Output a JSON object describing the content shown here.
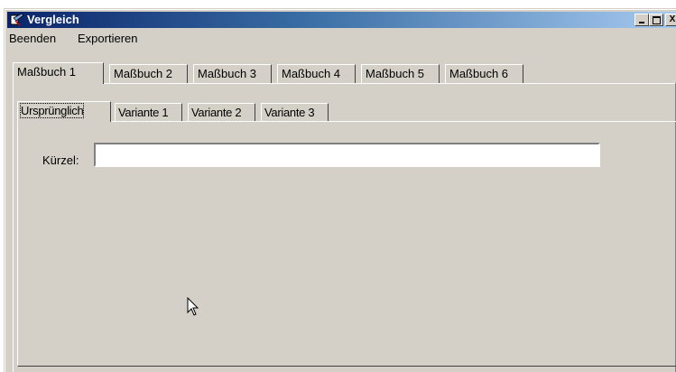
{
  "window": {
    "title": "Vergleich",
    "title_icon": "app-icon"
  },
  "title_buttons": {
    "minimize": "_",
    "maximize": "□",
    "close": "X"
  },
  "menu": [
    {
      "label": "Beenden"
    },
    {
      "label": "Exportieren"
    }
  ],
  "tabs_primary": [
    {
      "label": "Maßbuch 1",
      "active": true
    },
    {
      "label": "Maßbuch 2"
    },
    {
      "label": "Maßbuch 3"
    },
    {
      "label": "Maßbuch 4"
    },
    {
      "label": "Maßbuch 5"
    },
    {
      "label": "Maßbuch 6"
    }
  ],
  "tabs_secondary": [
    {
      "label": "Ursprünglich",
      "active": true
    },
    {
      "label": "Variante 1"
    },
    {
      "label": "Variante 2"
    },
    {
      "label": "Variante 3"
    }
  ],
  "form": {
    "kuerzel_label": "Kürzel:",
    "kuerzel_value": ""
  },
  "colors": {
    "face": "#d4d0c8",
    "title_start": "#0a246a",
    "title_end": "#a6caf0"
  }
}
